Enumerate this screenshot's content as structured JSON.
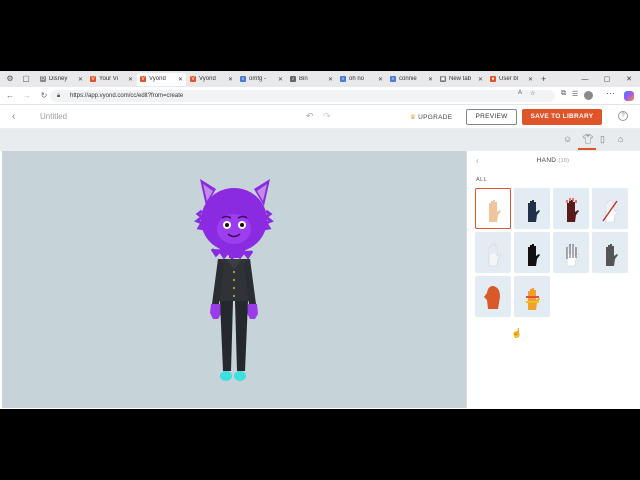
{
  "browser": {
    "tabs": [
      {
        "title": "Disney",
        "favicon": "D",
        "color": "#888"
      },
      {
        "title": "Your Vi",
        "favicon": "V",
        "color": "#e0542a"
      },
      {
        "title": "Vyond",
        "favicon": "V",
        "color": "#e0542a",
        "active": true
      },
      {
        "title": "Vyond",
        "favicon": "V",
        "color": "#e0542a"
      },
      {
        "title": "omfg -",
        "favicon": "⌕",
        "color": "#4a7bd1"
      },
      {
        "title": "Bin",
        "favicon": "♪",
        "color": "#666"
      },
      {
        "title": "oh no",
        "favicon": "⌕",
        "color": "#4a7bd1"
      },
      {
        "title": "connie",
        "favicon": "⌕",
        "color": "#4a7bd1"
      },
      {
        "title": "New tab",
        "favicon": "▣",
        "color": "#777"
      },
      {
        "title": "User bl",
        "favicon": "●",
        "color": "#e0542a"
      }
    ],
    "new_tab": "+",
    "url": "https://app.vyond.com/cc/edit?from=create"
  },
  "app": {
    "back_icon": "‹",
    "doc_title": "Untitled",
    "upgrade_label": "UPGRADE",
    "preview_label": "PREVIEW",
    "save_label": "SAVE TO LIBRARY",
    "help_icon": "?"
  },
  "panel": {
    "title": "HAND",
    "count": "(10)",
    "filter": "ALL",
    "items": [
      {
        "name": "skin-hand",
        "color": "#f1c4a0",
        "selected": true
      },
      {
        "name": "dark-glove",
        "color": "#23304a"
      },
      {
        "name": "red-glove",
        "color": "#5a1a1a"
      },
      {
        "name": "white-stripe-glove",
        "color": "#ffffff"
      },
      {
        "name": "white-glove",
        "color": "#f3f5f7"
      },
      {
        "name": "black-glove",
        "color": "#111111"
      },
      {
        "name": "skeleton-hand",
        "color": "#ffffff"
      },
      {
        "name": "gray-glove",
        "color": "#555555"
      },
      {
        "name": "orange-mitten",
        "color": "#d85a2a"
      },
      {
        "name": "rainbow-glove",
        "color": "#f0a030"
      }
    ]
  },
  "colors": {
    "accent": "#e0542a",
    "stage": "#c6d4da",
    "character_fur": "#8a2be2"
  }
}
